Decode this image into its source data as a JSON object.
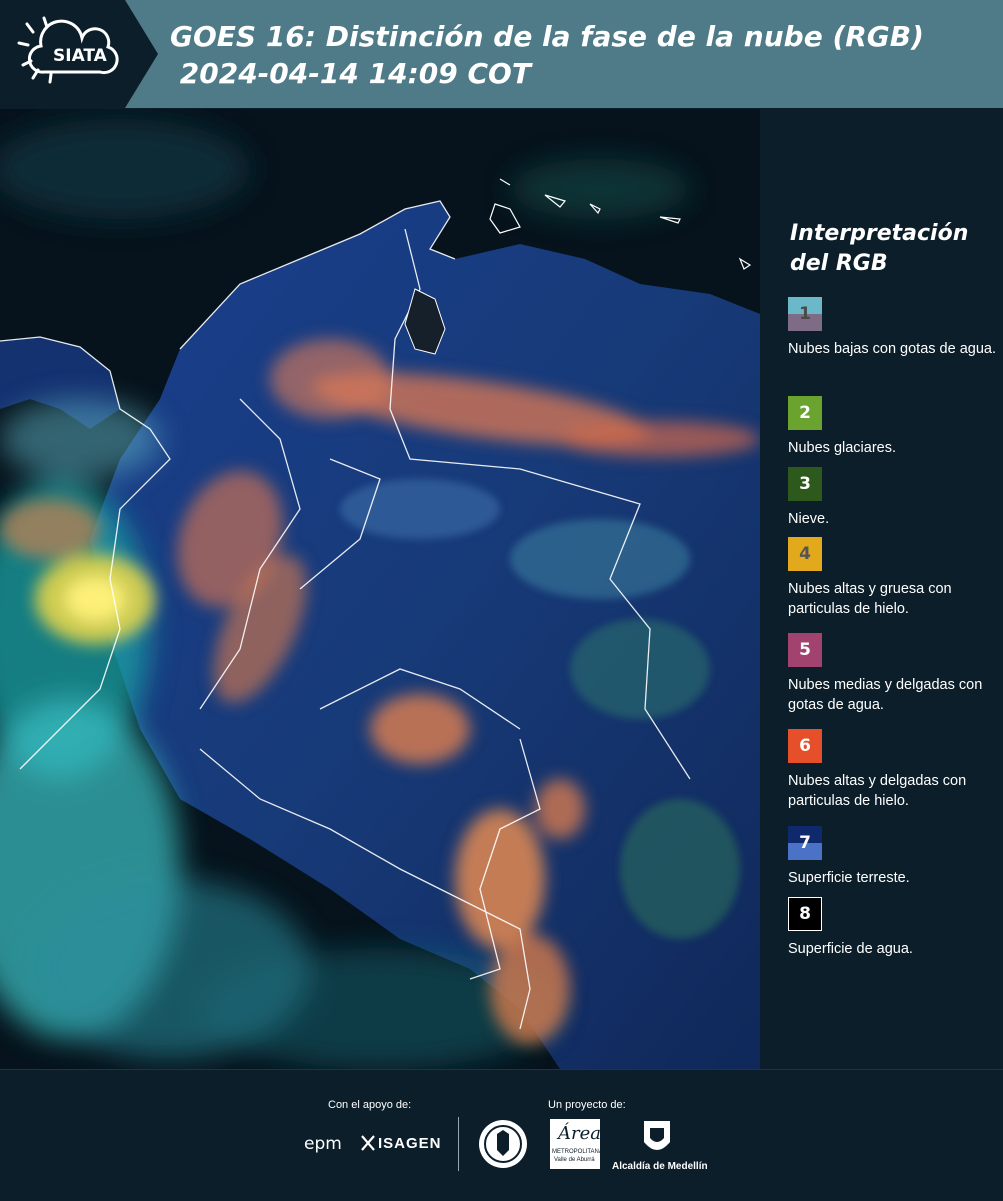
{
  "header": {
    "logo_text": "SIATA",
    "title_line1": "GOES 16: Distinción de la fase de la nube (RGB)",
    "title_line2": " 2024-04-14 14:09 COT"
  },
  "legend": {
    "title": "Interpretación del RGB",
    "items": [
      {
        "num": "1",
        "label": "Nubes bajas con gotas de agua.",
        "color_top": "#6ab8c8",
        "color_bottom": "#7e6c86",
        "num_color": "#4a4a4a"
      },
      {
        "num": "2",
        "label": "Nubes glaciares.",
        "color_top": "#6aa32d",
        "color_bottom": "#6aa32d",
        "num_color": "#ffffff"
      },
      {
        "num": "3",
        "label": "Nieve.",
        "color_top": "#2d5a1c",
        "color_bottom": "#2d5a1c",
        "num_color": "#ffffff"
      },
      {
        "num": "4",
        "label": "Nubes altas y gruesa con particulas de hielo.",
        "color_top": "#e2a91c",
        "color_bottom": "#e2a91c",
        "num_color": "#555555"
      },
      {
        "num": "5",
        "label": "Nubes medias y delgadas con gotas de agua.",
        "color_top": "#a2436f",
        "color_bottom": "#a2436f",
        "num_color": "#ffffff"
      },
      {
        "num": "6",
        "label": "Nubes altas y delgadas con particulas de hielo.",
        "color_top": "#e5502b",
        "color_bottom": "#e5502b",
        "num_color": "#ffffff"
      },
      {
        "num": "7",
        "label": "Superficie terreste.",
        "color_top": "#0e2a6c",
        "color_bottom": "#4a72c7",
        "num_color": "#ffffff"
      },
      {
        "num": "8",
        "label": "Superficie de agua.",
        "color_top": "#000000",
        "color_bottom": "#000000",
        "num_color": "#ffffff",
        "border": "#ffffff"
      }
    ]
  },
  "footer": {
    "support_label": "Con el apoyo de:",
    "support_logo1": "epm",
    "support_logo2": "ISAGEN",
    "project_label": "Un proyecto de:",
    "logo_area": "Área",
    "logo_area_sub1": "METROPOLITANA",
    "logo_area_sub2": "Valle de Aburrá",
    "logo_alcaldia": "Alcaldía de Medellín"
  }
}
